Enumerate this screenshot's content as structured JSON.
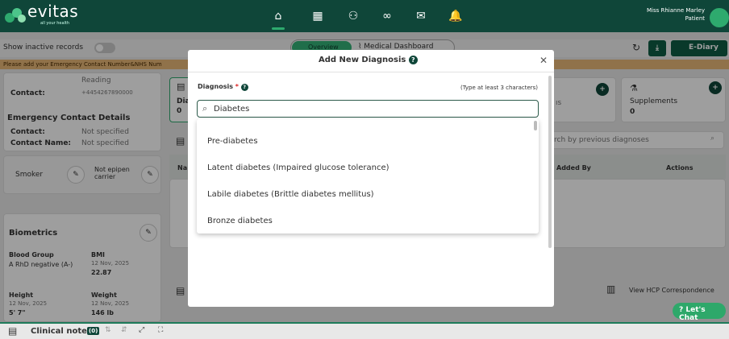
{
  "brand": {
    "name": "evitas",
    "tagline": "all your health"
  },
  "nav": {
    "icons": [
      "home-icon",
      "calendar-icon",
      "users-icon",
      "link-icon",
      "mail-icon",
      "bell-icon"
    ]
  },
  "user": {
    "name": "Miss Rhianne Marley",
    "role": "Patient"
  },
  "subbar": {
    "show_inactive": "Show inactive records",
    "tab_overview": "Overview",
    "tab_medical": "Medical Dashboard",
    "ediary": "E-Diary"
  },
  "alert": "Please add your Emergency Contact Number&NHS Num",
  "left": {
    "location": "Reading",
    "contact_label": "Contact:",
    "contact_value": "+4454267890000",
    "emergency_title": "Emergency Contact Details",
    "em_contact_label": "Contact:",
    "em_contact_value": "Not specified",
    "em_name_label": "Contact Name:",
    "em_name_value": "Not specified",
    "smoker": "Smoker",
    "epipen": "Not epipen carrier",
    "biometrics": "Biometrics",
    "blood_group_label": "Blood Group",
    "blood_group_value": "A RhD negative (A-)",
    "bmi_label": "BMI",
    "bmi_date": "12 Nov, 2025",
    "bmi_value": "22.87",
    "height_label": "Height",
    "height_date": "12 Nov, 2025",
    "height_value": "5' 7\"",
    "weight_label": "Weight",
    "weight_date": "12 Nov, 2025",
    "weight_value": "146 lb"
  },
  "main": {
    "dia_short": "Dia",
    "zero": "0",
    "is_fragment": "ıs",
    "supplements": "Supplements",
    "supplements_count": "0",
    "search_prev": "rch by previous diagnoses",
    "col_na": "Na",
    "col_added_by": "Added By",
    "col_actions": "Actions",
    "hcp": "View HCP Correspondence",
    "chat": "Let's Chat"
  },
  "modal": {
    "title": "Add New Diagnosis",
    "field_label": "Diagnosis",
    "required": "*",
    "hint": "(Type at least 3 characters)",
    "search_value": "Diabetes",
    "options": [
      "Pre-diabetes",
      "Latent diabetes (Impaired glucose tolerance)",
      "Labile diabetes (Brittle diabetes mellitus)",
      "Bronze diabetes"
    ]
  },
  "bottom": {
    "clinical": "Clinical note",
    "count": "(0)"
  }
}
